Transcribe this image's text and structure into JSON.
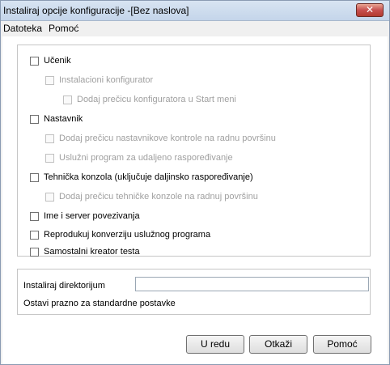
{
  "window": {
    "title": "Instaliraj opcije konfiguracije -[Bez naslova]",
    "close_glyph": "✕"
  },
  "menu": {
    "items": [
      {
        "label": "Datoteka"
      },
      {
        "label": "Pomoć"
      }
    ]
  },
  "options": [
    {
      "label": "Učenik",
      "checked": false,
      "enabled": true
    },
    {
      "label": "Instalacioni konfigurator",
      "checked": false,
      "enabled": false
    },
    {
      "label": "Dodaj prečicu konfiguratora u Start meni",
      "checked": false,
      "enabled": false
    },
    {
      "label": "Nastavnik",
      "checked": false,
      "enabled": true
    },
    {
      "label": "Dodaj prečicu nastavnikove kontrole na radnu površinu",
      "checked": false,
      "enabled": false
    },
    {
      "label": "Uslužni program za udaljeno raspoređivanje",
      "checked": false,
      "enabled": false
    },
    {
      "label": "Tehnička konzola (uključuje daljinsko raspoređivanje)",
      "checked": false,
      "enabled": true
    },
    {
      "label": "Dodaj prečicu tehničke konzole na radnuj površinu",
      "checked": false,
      "enabled": false
    },
    {
      "label": "Ime i server povezivanja",
      "checked": false,
      "enabled": true
    },
    {
      "label": "Reprodukuj konverziju uslužnog programa",
      "checked": false,
      "enabled": true
    },
    {
      "label": "Samostalni kreator testa",
      "checked": false,
      "enabled": true
    }
  ],
  "install_dir": {
    "label": "Instaliraj direktorijum",
    "value": "",
    "hint": "Ostavi prazno za standardne postavke"
  },
  "buttons": {
    "ok": "U redu",
    "cancel": "Otkaži",
    "help": "Pomoć"
  },
  "colors": {
    "close_button": "#c75050",
    "disabled_text": "#a0a0a0"
  }
}
